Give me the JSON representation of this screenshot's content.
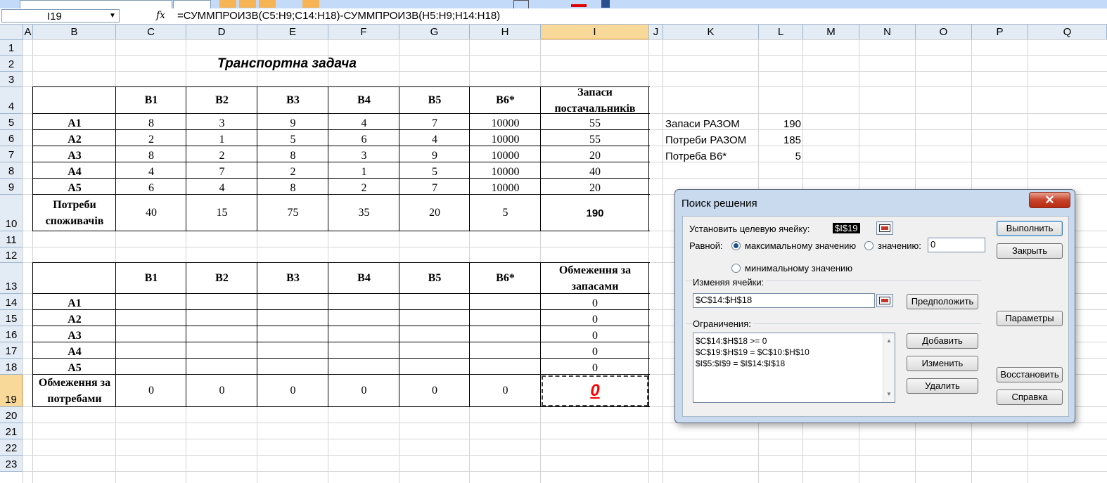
{
  "formula_bar": {
    "name_box": "I19",
    "fx_label": "fx",
    "formula": "=СУММПРОИЗВ(C5:H9;C14:H18)-СУММПРОИЗВ(H5:H9;H14:H18)"
  },
  "columns": [
    "A",
    "B",
    "C",
    "D",
    "E",
    "F",
    "G",
    "H",
    "I",
    "J",
    "K",
    "L",
    "M",
    "N",
    "O",
    "P",
    "Q"
  ],
  "rows": [
    "1",
    "2",
    "3",
    "4",
    "5",
    "6",
    "7",
    "8",
    "9",
    "10",
    "11",
    "12",
    "13",
    "14",
    "15",
    "16",
    "17",
    "18",
    "19",
    "20",
    "21",
    "22",
    "23"
  ],
  "sheet": {
    "title": "Транспортна задача",
    "table1": {
      "headers": [
        "B1",
        "B2",
        "B3",
        "B4",
        "B5",
        "B6*"
      ],
      "supply_header": "Запаси постачальників",
      "rows": [
        {
          "label": "A1",
          "values": [
            "8",
            "3",
            "9",
            "4",
            "7",
            "10000"
          ],
          "supply": "55"
        },
        {
          "label": "A2",
          "values": [
            "2",
            "1",
            "5",
            "6",
            "4",
            "10000"
          ],
          "supply": "55"
        },
        {
          "label": "A3",
          "values": [
            "8",
            "2",
            "8",
            "3",
            "9",
            "10000"
          ],
          "supply": "20"
        },
        {
          "label": "A4",
          "values": [
            "4",
            "7",
            "2",
            "1",
            "5",
            "10000"
          ],
          "supply": "40"
        },
        {
          "label": "A5",
          "values": [
            "6",
            "4",
            "8",
            "2",
            "7",
            "10000"
          ],
          "supply": "20"
        }
      ],
      "demand_label": "Потреби споживачів",
      "demand": [
        "40",
        "15",
        "75",
        "35",
        "20",
        "5"
      ],
      "demand_total": "190"
    },
    "table2": {
      "headers": [
        "B1",
        "B2",
        "B3",
        "B4",
        "B5",
        "B6*"
      ],
      "limit_header": "Обмеження за запасами",
      "row_labels": [
        "A1",
        "A2",
        "A3",
        "A4",
        "A5"
      ],
      "row_limits": [
        "0",
        "0",
        "0",
        "0",
        "0"
      ],
      "demand_limit_label": "Обмеження за потребами",
      "col_limits": [
        "0",
        "0",
        "0",
        "0",
        "0",
        "0"
      ],
      "objective": "0"
    },
    "summary": [
      {
        "label": "Запаси РАЗОМ",
        "value": "190"
      },
      {
        "label": "Потреби РАЗОМ",
        "value": "185"
      },
      {
        "label": "Потреба B6*",
        "value": "5"
      }
    ]
  },
  "dialog": {
    "title": "Поиск решения",
    "close_glyph": "✕",
    "target_label": "Установить целевую ячейку:",
    "target_value": "$I$19",
    "equal_label": "Равной:",
    "opt_max": "максимальному значению",
    "opt_value": "значению:",
    "value_field": "0",
    "opt_min": "минимальному значению",
    "changing_label": "Изменяя ячейки:",
    "changing_value": "$C$14:$H$18",
    "constraints_label": "Ограничения:",
    "constraints": [
      "$C$14:$H$18 >= 0",
      "$C$19:$H$19 = $C$10:$H$10",
      "$I$5:$I$9 = $I$14:$I$18"
    ],
    "buttons": {
      "solve": "Выполнить",
      "close": "Закрыть",
      "guess": "Предположить",
      "options": "Параметры",
      "add": "Добавить",
      "change": "Изменить",
      "delete": "Удалить",
      "reset": "Восстановить",
      "help": "Справка"
    }
  }
}
